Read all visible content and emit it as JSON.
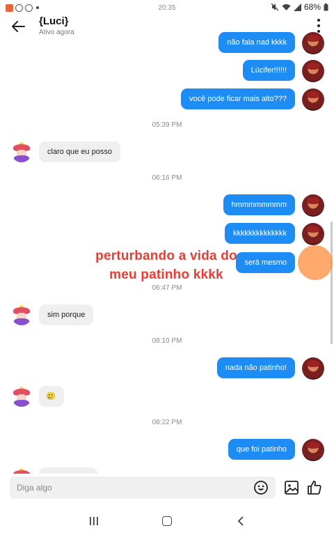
{
  "status_bar": {
    "time": "20:35",
    "battery": "68%"
  },
  "header": {
    "title": "{Luci}",
    "subtitle": "Ativo agora"
  },
  "messages": {
    "m1": "não fala nad kkkk",
    "m2": "Lúcifer!!!!!!",
    "m3": "você pode ficar mais alto???",
    "t1": "05:39 PM",
    "m4": "claro que eu posso",
    "t2": "06:16 PM",
    "m5": "hmmmmmmmm",
    "m6": "kkkkkkkkkkkkkk",
    "m7": "será mesmo",
    "t3": "06:47 PM",
    "m8": "sim porque",
    "t4": "08:10 PM",
    "m9": "nada não patinho!",
    "m10": "🥲",
    "t5": "08:22 PM",
    "m11": "que foi patinho"
  },
  "overlay": {
    "line1": "perturbando a vida do",
    "line2": "meu patinho kkkk"
  },
  "composer": {
    "placeholder": "Diga algo"
  },
  "colors": {
    "outgoing_bubble": "#1d8cf5",
    "incoming_bubble": "#efefef",
    "overlay_text": "#ee3b32"
  }
}
